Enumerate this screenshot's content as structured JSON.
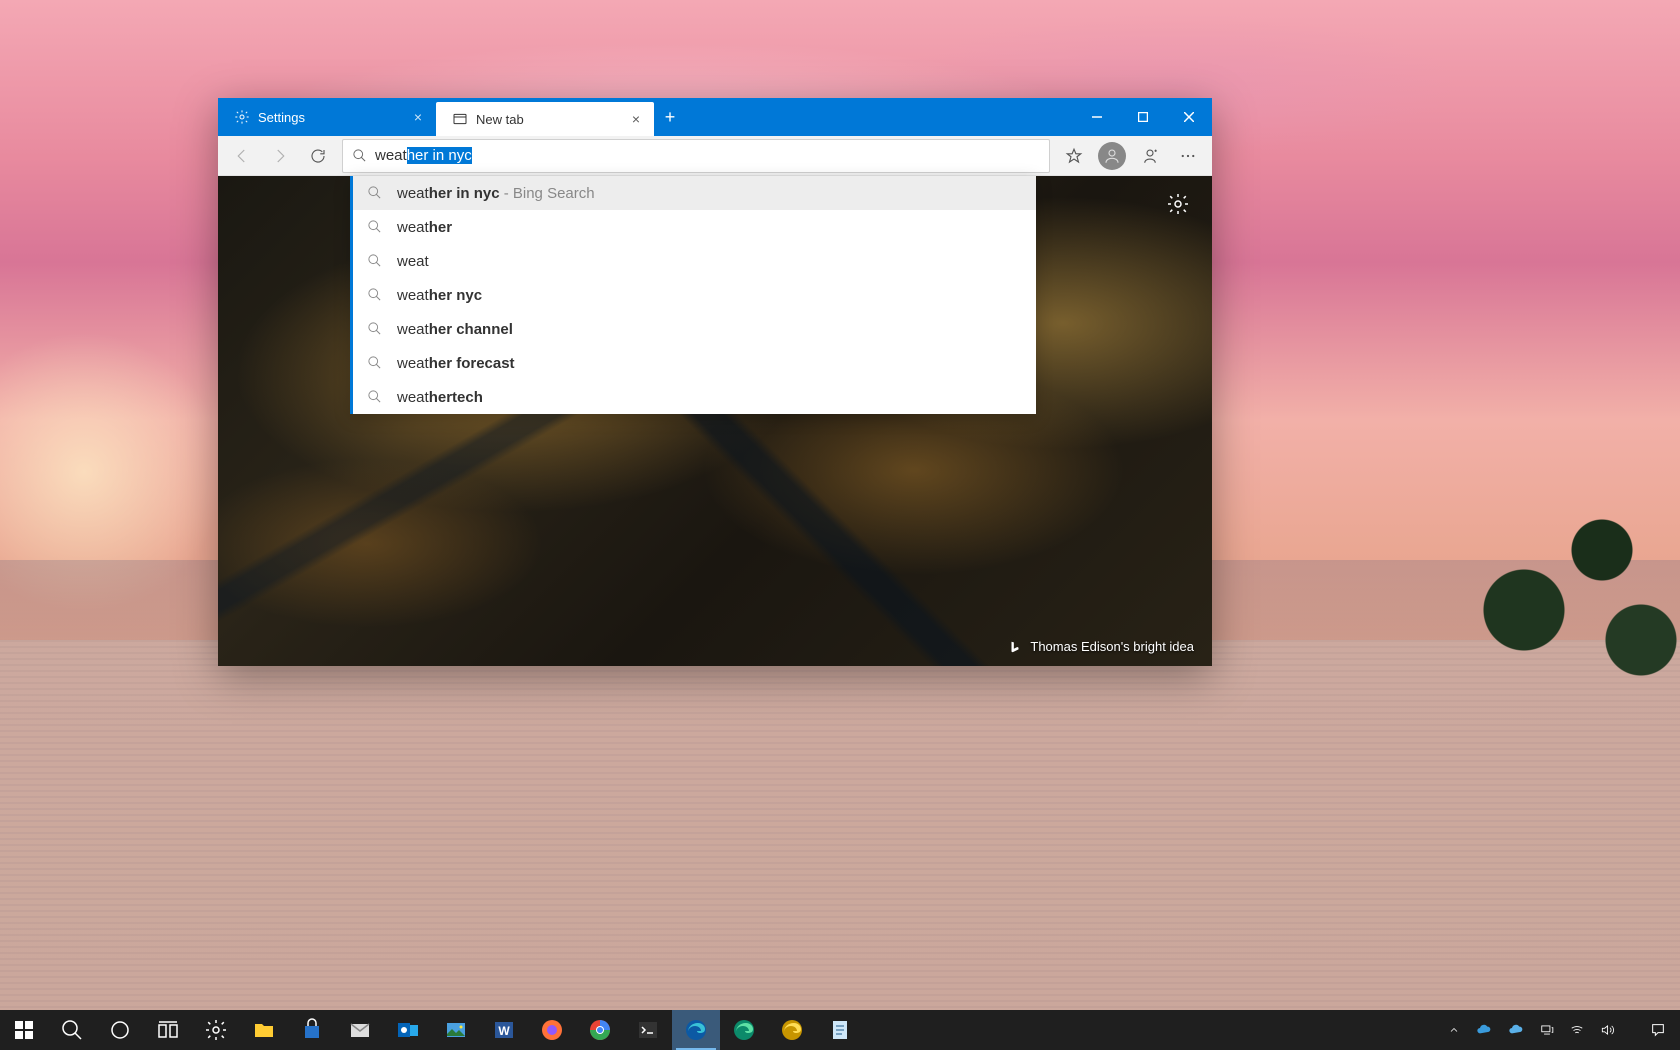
{
  "browser": {
    "tabs": [
      {
        "label": "Settings",
        "icon": "gear-icon",
        "active": false
      },
      {
        "label": "New tab",
        "icon": "newtab-icon",
        "active": true
      }
    ],
    "newtab_plus": "+",
    "address": {
      "typed_prefix": "weat",
      "autocomplete_suffix": "her in nyc"
    },
    "suggestions": [
      {
        "pre": "weat",
        "bold": "her in nyc",
        "suffix": " - Bing Search",
        "active": true
      },
      {
        "pre": "weat",
        "bold": "her",
        "suffix": "",
        "active": false
      },
      {
        "pre": "weat",
        "bold": "",
        "suffix": "",
        "active": false
      },
      {
        "pre": "weat",
        "bold": "her nyc",
        "suffix": "",
        "active": false
      },
      {
        "pre": "weat",
        "bold": "her channel",
        "suffix": "",
        "active": false
      },
      {
        "pre": "weat",
        "bold": "her forecast",
        "suffix": "",
        "active": false
      },
      {
        "pre": "weat",
        "bold": "hertech",
        "suffix": "",
        "active": false
      }
    ],
    "newtab_caption": "Thomas Edison's bright idea"
  },
  "taskbar": {
    "items": [
      "start-icon",
      "search-icon",
      "cortana-icon",
      "taskview-icon",
      "settings-icon",
      "explorer-icon",
      "store-icon",
      "mail-icon",
      "outlook-icon",
      "photos-icon",
      "word-icon",
      "firefox-icon",
      "chrome-icon",
      "terminal-icon",
      "edge-icon",
      "edge-beta-icon",
      "edge-canary-icon",
      "notepad-icon"
    ],
    "active_index": 14,
    "tray": {
      "time": "",
      "date": ""
    }
  }
}
